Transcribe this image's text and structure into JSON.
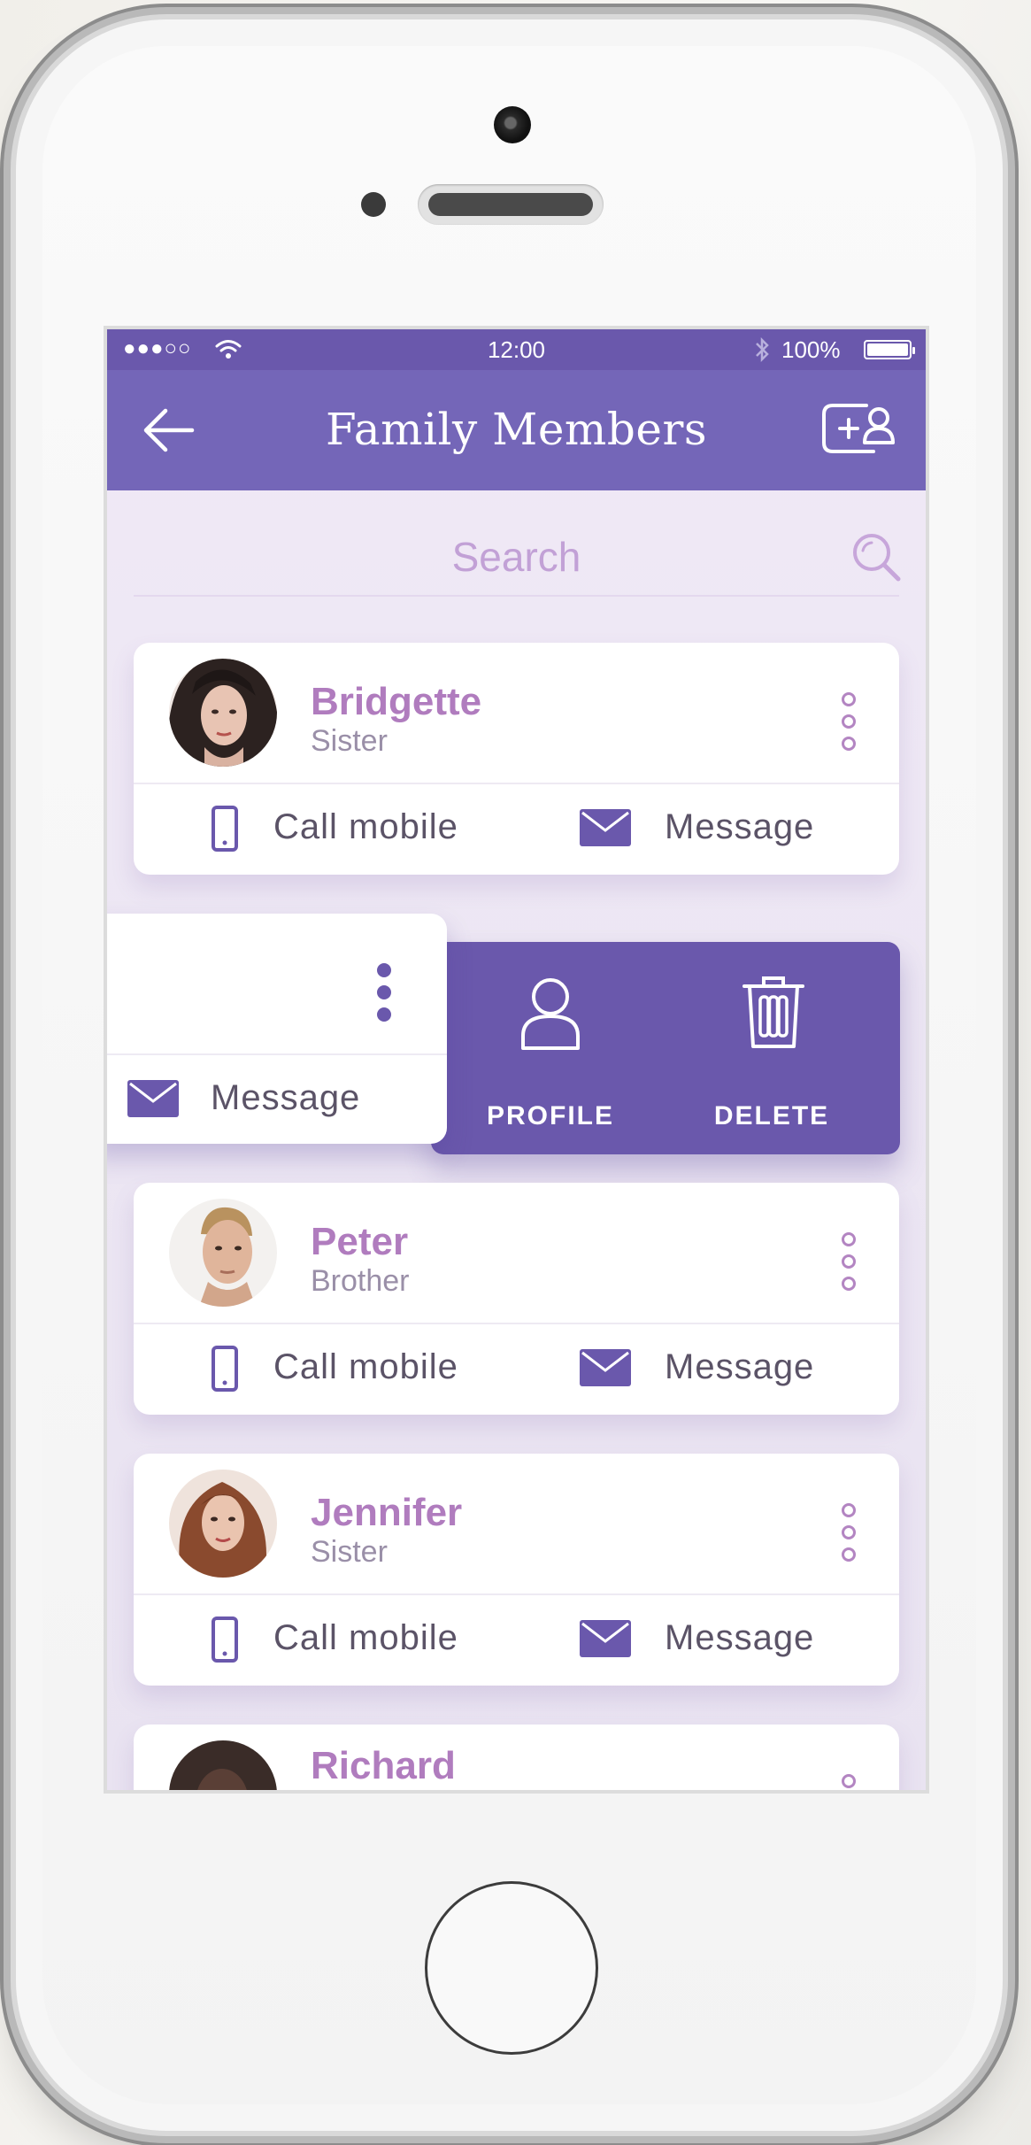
{
  "status_bar": {
    "signal": "●●●○○",
    "time": "12:00",
    "battery": "100%"
  },
  "nav": {
    "title": "Family Members"
  },
  "search": {
    "placeholder": "Search"
  },
  "contacts": [
    {
      "name": "Bridgette",
      "relation": "Sister",
      "call_label": "Call mobile",
      "message_label": "Message"
    },
    {
      "message_label": "Message"
    },
    {
      "name": "Peter",
      "relation": "Brother",
      "call_label": "Call mobile",
      "message_label": "Message"
    },
    {
      "name": "Jennifer",
      "relation": "Sister",
      "call_label": "Call mobile",
      "message_label": "Message"
    },
    {
      "name": "Richard"
    }
  ],
  "swipe_actions": {
    "profile_label": "PROFILE",
    "delete_label": "DELETE"
  },
  "colors": {
    "primary": "#6a58ac",
    "navbar": "#7466b8",
    "name_accent": "#b07cbe",
    "search_text": "#c2a1d6"
  },
  "icons": [
    "back-arrow-icon",
    "add-contact-icon",
    "search-icon",
    "more-vertical-icon",
    "phone-icon",
    "mail-icon",
    "user-icon",
    "trash-icon"
  ]
}
